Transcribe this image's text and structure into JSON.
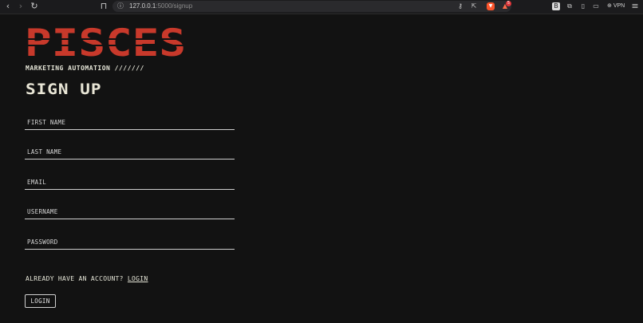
{
  "browser": {
    "url_host": "127.0.0.1",
    "url_path": ":5000/signup",
    "notification_count": "5",
    "vpn_label": "VPN"
  },
  "brand": {
    "logo_text": "PISCES",
    "logo_color": "#c8392b",
    "tagline": "MARKETING AUTOMATION ///////"
  },
  "form": {
    "title": "SIGN UP",
    "fields": [
      {
        "name": "first_name",
        "placeholder": "FIRST NAME"
      },
      {
        "name": "last_name",
        "placeholder": "LAST NAME"
      },
      {
        "name": "email",
        "placeholder": "EMAIL"
      },
      {
        "name": "username",
        "placeholder": "USERNAME"
      },
      {
        "name": "password",
        "placeholder": "PASSWORD"
      }
    ]
  },
  "footer": {
    "account_prompt": "ALREADY HAVE AN ACCOUNT?",
    "login_link": "LOGIN",
    "login_button": "LOGIN"
  }
}
